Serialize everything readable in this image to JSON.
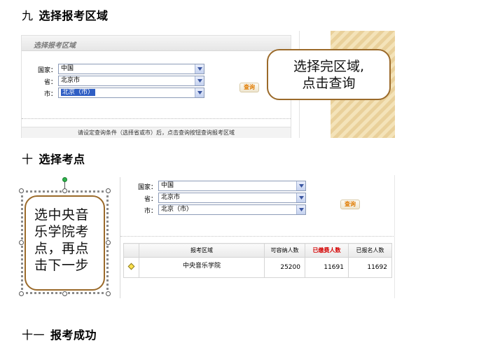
{
  "sections": [
    {
      "number": "九",
      "title": "选择报考区域"
    },
    {
      "number": "十",
      "title": "选择考点"
    },
    {
      "number": "十一",
      "title": "报考成功"
    }
  ],
  "shot1": {
    "panel_title": "选择报考区域",
    "country_label": "国家：",
    "country_value": "中国",
    "province_label": "省：",
    "province_value": "北京市",
    "city_label": "市：",
    "city_value": "北京（市）",
    "query_button": "查询",
    "note": "请设定查询条件（选择省或市）后，点击查询按钮查询报考区域",
    "callout_line1": "选择完区域,",
    "callout_line2": "点击查询"
  },
  "shot2": {
    "country_label": "国家：",
    "country_value": "中国",
    "province_label": "省：",
    "province_value": "北京市",
    "city_label": "市：",
    "city_value": "北京（市）",
    "query_button": "查询",
    "table": {
      "headers": [
        "报考区域",
        "可容纳人数",
        "已缴费人数",
        "已报名人数"
      ],
      "rows": [
        {
          "area": "中央音乐学院",
          "capacity": "25200",
          "paid": "11691",
          "registered": "11692"
        }
      ]
    },
    "callout_lines": [
      "选中央音",
      "乐学院考",
      "点，再点",
      "击下一步"
    ]
  },
  "colors": {
    "callout_border": "#9b6a2a",
    "paid_header": "#d40000",
    "query_text": "#e07b00",
    "selected_bg": "#2f5ec4"
  }
}
